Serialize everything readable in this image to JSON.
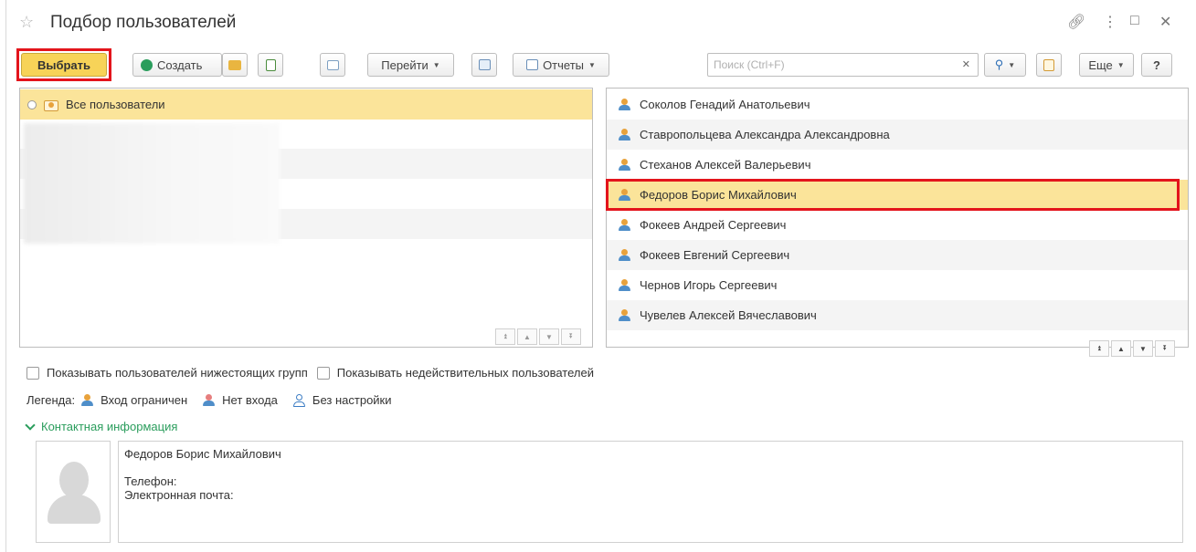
{
  "window": {
    "title": "Подбор пользователей"
  },
  "toolbar": {
    "select_label": "Выбрать",
    "create_label": "Создать",
    "goto_label": "Перейти",
    "reports_label": "Отчеты",
    "more_label": "Еще",
    "help_label": "?"
  },
  "search": {
    "placeholder": "Поиск (Ctrl+F)",
    "value": ""
  },
  "groups": {
    "items": [
      {
        "label": "Все пользователи",
        "selected": true
      }
    ]
  },
  "users": {
    "items": [
      {
        "name": "Соколов Генадий Анатольевич"
      },
      {
        "name": "Ставропольцева Александра Александровна"
      },
      {
        "name": "Стеханов Алексей Валерьевич"
      },
      {
        "name": "Федоров Борис Михайлович",
        "selected": true
      },
      {
        "name": "Фокеев Андрей Сергеевич"
      },
      {
        "name": "Фокеев Евгений Сергеевич"
      },
      {
        "name": "Чернов Игорь Сергеевич"
      },
      {
        "name": "Чувелев Алексей Вячеславович"
      }
    ]
  },
  "options": {
    "show_subgroups": "Показывать пользователей нижестоящих групп",
    "show_invalid": "Показывать недействительных пользователей"
  },
  "legend": {
    "title": "Легенда:",
    "restricted": "Вход ограничен",
    "no_login": "Нет входа",
    "no_setup": "Без настройки"
  },
  "contact": {
    "section_label": "Контактная информация",
    "name": "Федоров Борис Михайлович",
    "phone_label": "Телефон:",
    "email_label": "Электронная почта:"
  },
  "colors": {
    "primary_button": "#f7d358",
    "selection_row": "#fbe49a",
    "highlight_frame": "#e3141c",
    "accent_green": "#2a9d5c"
  }
}
